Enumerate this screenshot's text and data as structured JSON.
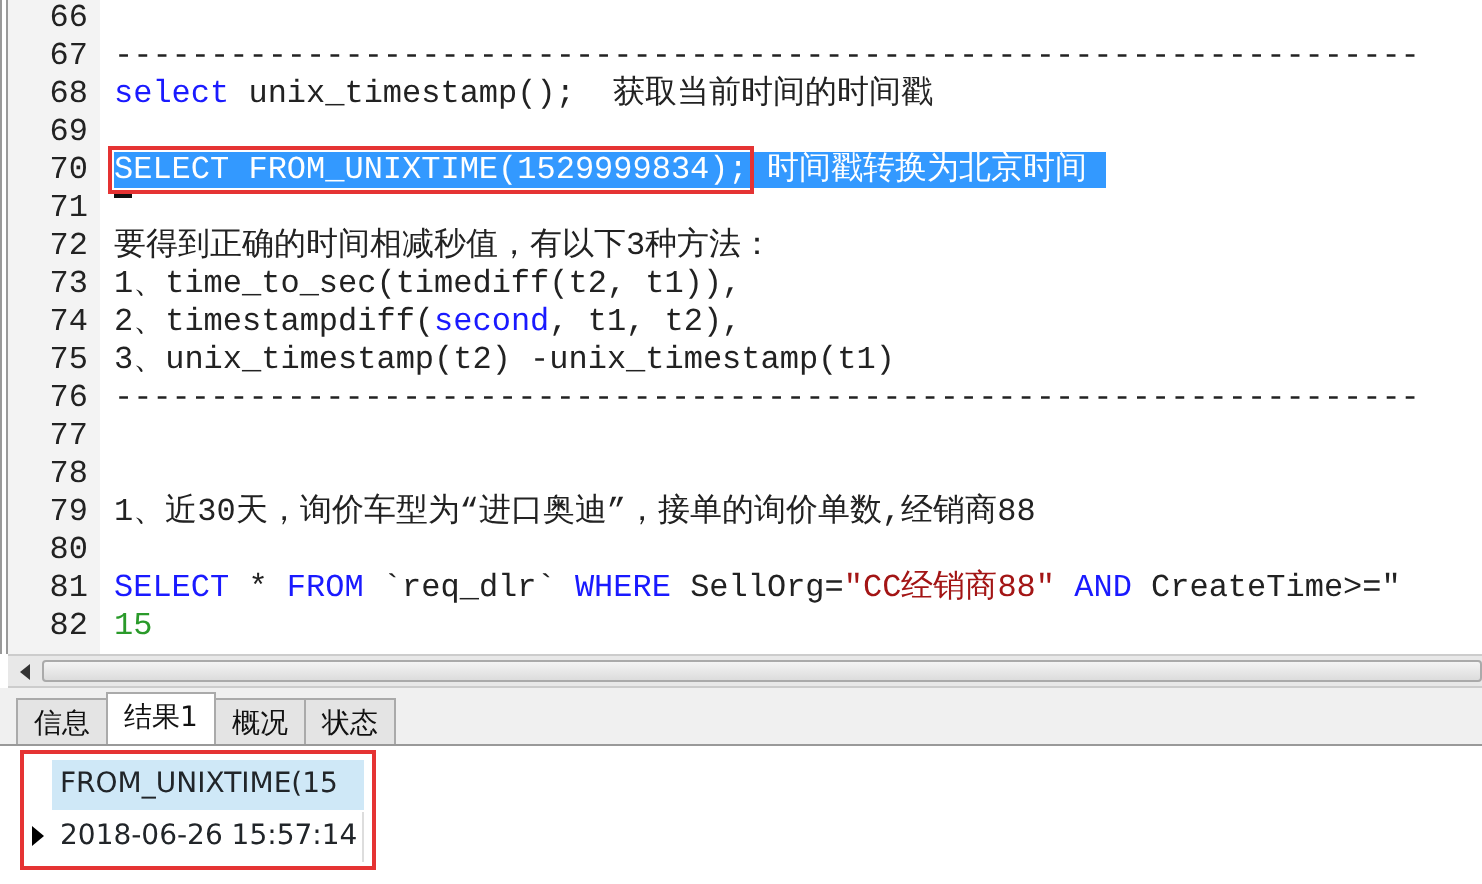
{
  "editor": {
    "lines": [
      {
        "number": "66"
      },
      {
        "number": "67",
        "segments": [
          {
            "kind": "plain",
            "text": "--------------------------------------------------------------------"
          }
        ]
      },
      {
        "number": "68",
        "segments": [
          {
            "kind": "keyword",
            "text": "select"
          },
          {
            "kind": "plain",
            "text": " unix_timestamp();  获取当前时间的时间戳"
          }
        ]
      },
      {
        "number": "69"
      },
      {
        "number": "70",
        "selected": true,
        "segments": [
          {
            "kind": "plain",
            "text": "SELECT FROM_UNIXTIME(1529999834);",
            "boxed": true
          },
          {
            "kind": "plain",
            "text": " 时间戳转换为北京时间"
          }
        ]
      },
      {
        "number": "71",
        "cursor": true
      },
      {
        "number": "72",
        "segments": [
          {
            "kind": "plain",
            "text": "要得到正确的时间相减秒值，有以下3种方法："
          }
        ]
      },
      {
        "number": "73",
        "segments": [
          {
            "kind": "plain",
            "text": "1、time_to_sec(timediff(t2, t1)),"
          }
        ]
      },
      {
        "number": "74",
        "segments": [
          {
            "kind": "plain",
            "text": "2、timestampdiff("
          },
          {
            "kind": "keyword",
            "text": "second"
          },
          {
            "kind": "plain",
            "text": ", t1, t2),"
          }
        ]
      },
      {
        "number": "75",
        "segments": [
          {
            "kind": "plain",
            "text": "3、unix_timestamp(t2) -unix_timestamp(t1)"
          }
        ]
      },
      {
        "number": "76",
        "segments": [
          {
            "kind": "plain",
            "text": "--------------------------------------------------------------------"
          }
        ]
      },
      {
        "number": "77"
      },
      {
        "number": "78"
      },
      {
        "number": "79",
        "segments": [
          {
            "kind": "plain",
            "text": "1、近30天，询价车型为“进口奥迪”，接单的询价单数,经销商88"
          }
        ]
      },
      {
        "number": "80"
      },
      {
        "number": "81",
        "segments": [
          {
            "kind": "keyword",
            "text": "SELECT"
          },
          {
            "kind": "plain",
            "text": " * "
          },
          {
            "kind": "keyword",
            "text": "FROM"
          },
          {
            "kind": "plain",
            "text": " `req_dlr` "
          },
          {
            "kind": "keyword",
            "text": "WHERE"
          },
          {
            "kind": "plain",
            "text": " SellOrg="
          },
          {
            "kind": "string",
            "text": "\"CC经销商88\" "
          },
          {
            "kind": "keyword",
            "text": "AND"
          },
          {
            "kind": "plain",
            "text": " CreateTime>=\""
          }
        ]
      },
      {
        "number": "82",
        "segments": [
          {
            "kind": "number",
            "text": "15"
          }
        ]
      }
    ]
  },
  "tabs": [
    {
      "label": "信息",
      "selected": false
    },
    {
      "label": "结果1",
      "selected": true
    },
    {
      "label": "概况",
      "selected": false
    },
    {
      "label": "状态",
      "selected": false
    }
  ],
  "result": {
    "boxed": true,
    "columns": [
      "FROM_UNIXTIME(15"
    ],
    "rows": [
      {
        "current": true,
        "cells": [
          "2018-06-26 15:57:14"
        ]
      }
    ]
  }
}
